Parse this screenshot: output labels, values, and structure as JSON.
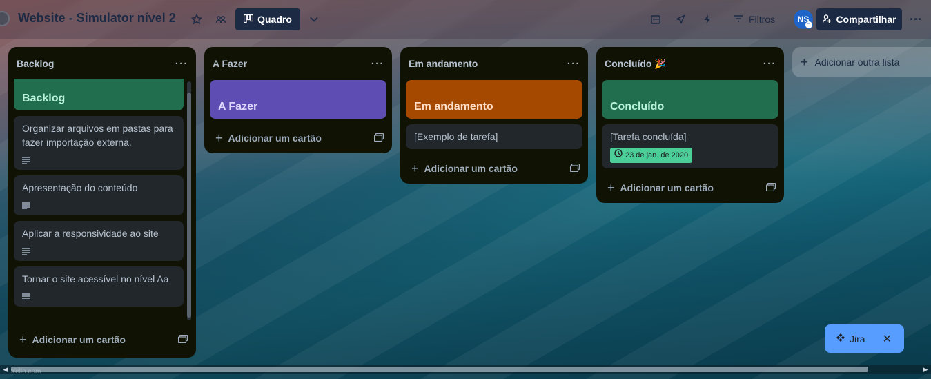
{
  "header": {
    "board_title": "Website - Simulator nível 2",
    "view_label": "Quadro",
    "filters_label": "Filtros",
    "avatar_initials": "NS",
    "share_label": "Compartilhar"
  },
  "lists": [
    {
      "title": "Backlog",
      "cover": {
        "label": "Backlog",
        "color": "#216e4e",
        "text_color": "#baf3db"
      },
      "cards": [
        {
          "title": "Organizar arquivos em pastas para fazer importação externa."
        },
        {
          "title": "Apresentação do conteúdo"
        },
        {
          "title": "Aplicar a responsividade ao site"
        },
        {
          "title": "Tornar o site acessível no nível Aa"
        }
      ],
      "add_label": "Adicionar um cartão"
    },
    {
      "title": "A Fazer",
      "cover": {
        "label": "A Fazer",
        "color": "#5e4db2",
        "text_color": "#dfd8fd"
      },
      "cards": [],
      "add_label": "Adicionar um cartão"
    },
    {
      "title": "Em andamento",
      "cover": {
        "label": "Em andamento",
        "color": "#a54800",
        "text_color": "#fedec8"
      },
      "cards": [
        {
          "title": "[Exemplo de tarefa]"
        }
      ],
      "add_label": "Adicionar um cartão"
    },
    {
      "title": "Concluído 🎉",
      "cover": {
        "label": "Concluído",
        "color": "#216e4e",
        "text_color": "#baf3db"
      },
      "cards": [
        {
          "title": "[Tarefa concluída]",
          "date": "23 de jan. de 2020"
        }
      ],
      "add_label": "Adicionar um cartão"
    }
  ],
  "add_list_label": "Adicionar outra lista",
  "jira": {
    "label": "Jira"
  },
  "footer_url": "trello.com",
  "colors": {
    "accent": "#1d2a44",
    "list_bg": "#101204",
    "card_bg": "#22272b",
    "date_badge": "#4bce97",
    "jira_bg": "#579dff"
  }
}
